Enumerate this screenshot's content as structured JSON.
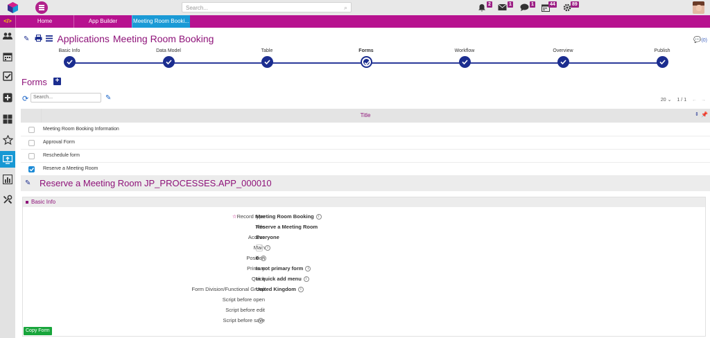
{
  "search": {
    "placeholder": "Search..."
  },
  "notifications": {
    "bell": "2",
    "mail": "1",
    "chat": "1",
    "calendar": "44",
    "settings": "89"
  },
  "nav": {
    "dev_label": "</>",
    "tabs": [
      {
        "label": "Home"
      },
      {
        "label": "App Builder"
      },
      {
        "label": "Meeting Room Booki..."
      }
    ]
  },
  "header": {
    "prefix": "Applications",
    "title": "Meeting Room Booking",
    "comments": "(0)"
  },
  "steps": [
    {
      "label": "Basic Info"
    },
    {
      "label": "Data Model"
    },
    {
      "label": "Table"
    },
    {
      "label": "Forms"
    },
    {
      "label": "Workflow"
    },
    {
      "label": "Overview"
    },
    {
      "label": "Publish"
    }
  ],
  "forms": {
    "title": "Forms",
    "search_placeholder": "Search...",
    "page_size": "20",
    "page_info": "1 / 1",
    "column_title": "Title",
    "rows": [
      {
        "title": "Meeting Room Booking Information",
        "checked": false
      },
      {
        "title": "Approval Form",
        "checked": false
      },
      {
        "title": "Reschedule form",
        "checked": false
      },
      {
        "title": "Reserve a Meeting Room",
        "checked": true
      }
    ]
  },
  "detail": {
    "title": "Reserve a Meeting Room JP_PROCESSES.APP_000010",
    "panel_title": "Basic Info",
    "fields": [
      {
        "label": "Record type",
        "value": "Meeting Room Booking",
        "info": true,
        "required": true
      },
      {
        "label": "Title",
        "value": "Reserve a Meeting Room",
        "info": false
      },
      {
        "label": "Access",
        "value": "Everyone",
        "info": false
      },
      {
        "label": "Main",
        "value": "",
        "info": true,
        "checkbox": true
      },
      {
        "label": "Position",
        "value": "0",
        "info": true
      },
      {
        "label": "Primary",
        "value": "Is not primary form",
        "info": true
      },
      {
        "label": "Quick",
        "value": "In quick add menu",
        "info": true
      },
      {
        "label": "Form Division/Functional Group",
        "value": "United Kingdom",
        "info": true
      },
      {
        "label": "Script before open",
        "value": "",
        "info": false
      },
      {
        "label": "Script before edit",
        "value": "",
        "info": false
      },
      {
        "label": "Script before save",
        "value": "",
        "info": true
      }
    ],
    "copy_button": "Copy Form"
  },
  "colors": {
    "brand": "#b7128f",
    "accent": "#1b2d8f",
    "active_tab": "#1a9ad6",
    "title": "#8e1279",
    "success": "#18a53b"
  }
}
